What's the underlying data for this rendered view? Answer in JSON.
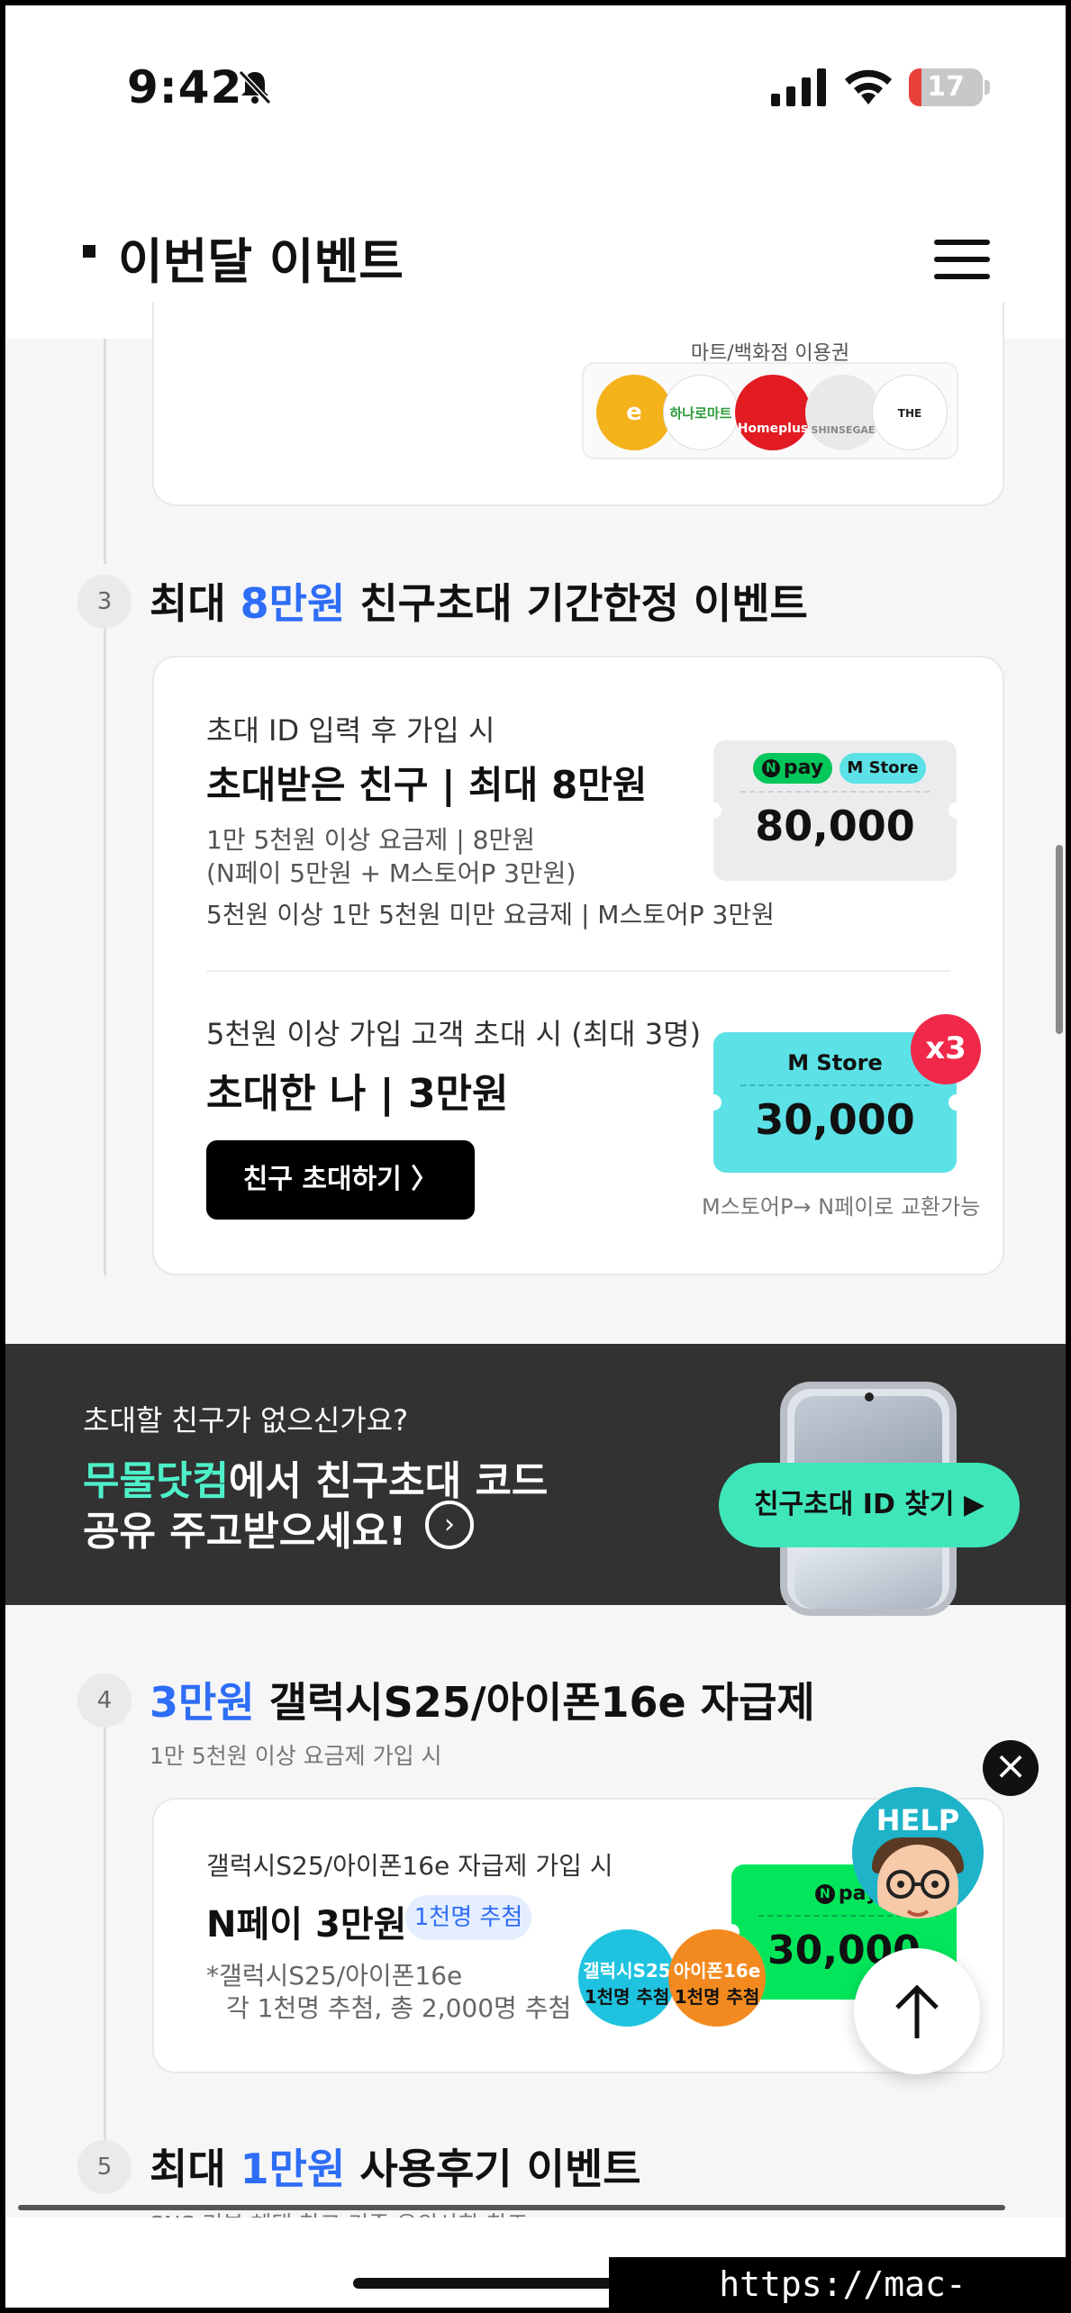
{
  "status_bar": {
    "time": "9:42",
    "battery_level": "17",
    "battery_fraction": 0.17
  },
  "header": {
    "title": "이번달 이벤트",
    "menu_icon": "hamburger-icon"
  },
  "top_card": {
    "mart_title": "마트/백화점 이용권",
    "logos": [
      {
        "name": "emart",
        "text": "e mart",
        "bg": "#f4b21b"
      },
      {
        "name": "hanaro",
        "text": "하나로마트",
        "bg": "#ffffff"
      },
      {
        "name": "homeplus",
        "text": "Homeplus",
        "bg": "#e21a22"
      },
      {
        "name": "shinsegae",
        "text": "SHINSEGAE",
        "bg": "#e9e9e9"
      },
      {
        "name": "hyundai",
        "text": "THE HYUNDAI",
        "bg": "#ffffff"
      }
    ]
  },
  "step3": {
    "num": "3",
    "head_pre": "최대 ",
    "head_blue": "8만원",
    "head_post": " 친구초대 기간한정 이벤트",
    "friend": {
      "small": "초대 ID 입력 후 가입 시",
      "big": "초대받은 친구 | 최대 8만원",
      "line1": "1만 5천원 이상 요금제  |  8만원",
      "line2": "(N페이 5만원 + M스토어P 3만원)",
      "line3": "5천원 이상 1만 5천원 미만 요금제  |  M스토어P 3만원",
      "npay": "pay",
      "mstore": "M Store",
      "amount": "80,000"
    },
    "me": {
      "small": "5천원 이상 가입 고객 초대 시 (최대 3명)",
      "big": "초대한 나 | 3만원",
      "button": "친구 초대하기 〉",
      "mstore": "M Store",
      "amount": "30,000",
      "multiplier": "x3",
      "exchange_note": "M스토어P→ N페이로 교환가능"
    }
  },
  "banner": {
    "question": "초대할 친구가 없으신가요?",
    "line1_green": "무물닷컴",
    "line1_rest": "에서 친구초대 코드",
    "line2": "공유 주고받으세요!",
    "button": "친구초대 ID 찾기 ▶"
  },
  "step4": {
    "num": "4",
    "head_blue": "3만원",
    "head_post": " 갤럭시S25/아이폰16e 자급제",
    "sub": "1만 5천원 이상 요금제 가입 시",
    "card": {
      "small": "갤럭시S25/아이폰16e 자급제 가입 시",
      "big": "N페이 3만원",
      "badge": "1천명 추첨",
      "note1": "*갤럭시S25/아이폰16e",
      "note2": "각 1천명 추첨, 총 2,000명 추첨",
      "npay": "pay",
      "amount": "30,000",
      "bubble1_a": "갤럭시S25",
      "bubble1_b": "1천명 추첨",
      "bubble2_a": "아이폰16e",
      "bubble2_b": "1천명 추첨"
    }
  },
  "floating": {
    "help": "HELP",
    "close": "×",
    "up": "↑"
  },
  "step5": {
    "num": "5",
    "head_pre": "최대 ",
    "head_blue": "1만원",
    "head_post": " 사용후기 이벤트",
    "sub": "SNS 리뷰 혜택 참고 기준 유의사항 참조"
  },
  "watermark": "https://mac-os.tistory.com",
  "colors": {
    "accent_blue": "#2e6df6",
    "npay_green": "#03c75a",
    "mstore_teal": "#5ce1e6",
    "invite_green": "#3fe6ba",
    "badge_red": "#f0284a"
  }
}
